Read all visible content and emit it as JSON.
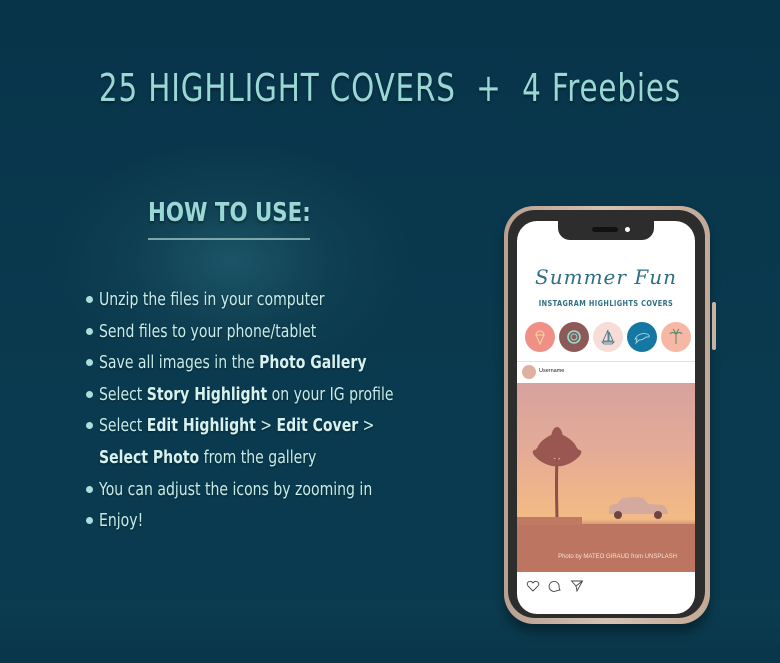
{
  "headline": "25 HIGHLIGHT COVERS  +  4 Freebies",
  "how_to": {
    "title": "HOW TO USE:",
    "steps": [
      {
        "segments": [
          {
            "t": "Unzip the files in your computer",
            "b": false
          }
        ],
        "bullet": true
      },
      {
        "segments": [
          {
            "t": "Send files to your phone/tablet",
            "b": false
          }
        ],
        "bullet": true
      },
      {
        "segments": [
          {
            "t": "Save all images in the ",
            "b": false
          },
          {
            "t": "Photo Gallery",
            "b": true
          }
        ],
        "bullet": true
      },
      {
        "segments": [
          {
            "t": "Select ",
            "b": false
          },
          {
            "t": "Story Highlight",
            "b": true
          },
          {
            "t": " on your IG profile",
            "b": false
          }
        ],
        "bullet": true
      },
      {
        "segments": [
          {
            "t": "Select ",
            "b": false
          },
          {
            "t": "Edit Highlight",
            "b": true
          },
          {
            "t": " > ",
            "b": false
          },
          {
            "t": "Edit Cover",
            "b": true
          },
          {
            "t": " >",
            "b": false
          }
        ],
        "bullet": true
      },
      {
        "segments": [
          {
            "t": "Select Photo",
            "b": true
          },
          {
            "t": " from the gallery",
            "b": false
          }
        ],
        "bullet": false
      },
      {
        "segments": [
          {
            "t": "You can adjust the icons by zooming in",
            "b": false
          }
        ],
        "bullet": true
      },
      {
        "segments": [
          {
            "t": "Enjoy!",
            "b": false
          }
        ],
        "bullet": true
      }
    ]
  },
  "phone": {
    "script_title": "Summer Fun",
    "subtitle": "INSTAGRAM   HIGHLIGHTS   COVERS",
    "highlights": [
      {
        "icon": "ice-cream-icon",
        "bg": "#ef8f86"
      },
      {
        "icon": "lifebuoy-icon",
        "bg": "#8d5a58"
      },
      {
        "icon": "sailboat-icon",
        "bg": "#f7dcd8"
      },
      {
        "icon": "dolphin-icon",
        "bg": "#1478a3"
      },
      {
        "icon": "palm-tree-icon",
        "bg": "#f6b8a4"
      }
    ],
    "username": "Username",
    "photo_credit": "Photo by MATEO GIRAUD from UNSPLASH",
    "actions": [
      "heart-icon",
      "comment-icon",
      "send-icon"
    ]
  },
  "colors": {
    "background": "#0a3a4f",
    "accent_text": "#9ad8d5",
    "body_text": "#c7ebe8"
  }
}
